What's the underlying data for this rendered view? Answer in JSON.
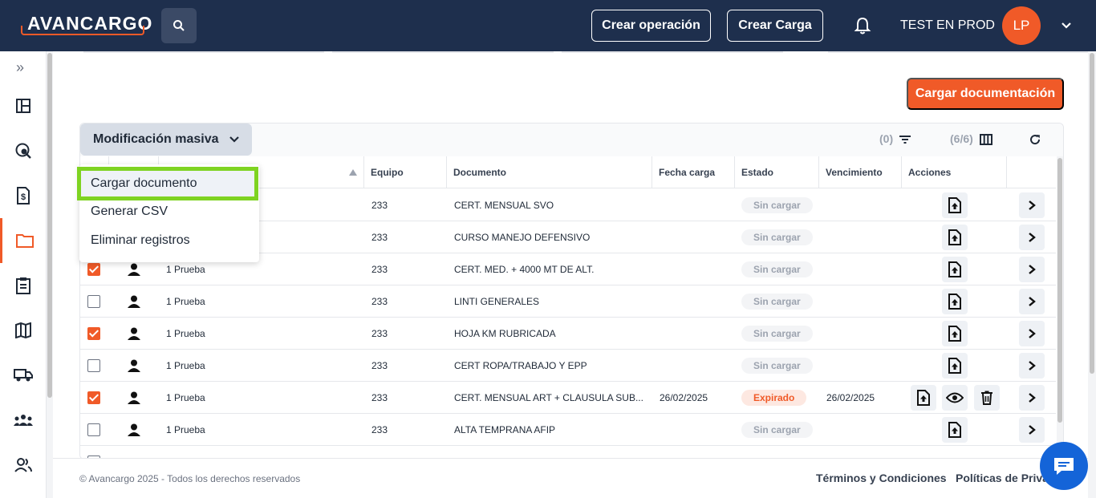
{
  "header": {
    "logo_text": "AVANCARGO",
    "crear_operacion": "Crear operación",
    "crear_carga": "Crear Carga",
    "username": "TEST EN PROD",
    "avatar_initials": "LP"
  },
  "main": {
    "cargar_documentacion": "Cargar documentación"
  },
  "toolbar": {
    "masiva_label": "Modificación masiva",
    "filter_count": "(0)",
    "columns_count": "(6/6)"
  },
  "dropdown": {
    "items": [
      "Cargar documento",
      "Generar CSV",
      "Eliminar registros"
    ]
  },
  "table": {
    "headers": {
      "equipo": "Equipo",
      "documento": "Documento",
      "fecha_carga": "Fecha carga",
      "estado": "Estado",
      "vencimiento": "Vencimiento",
      "acciones": "Acciones"
    },
    "rows": [
      {
        "checked": false,
        "name": "",
        "equipo": "233",
        "documento": "CERT. MENSUAL SVO",
        "fecha": "",
        "estado": "Sin cargar",
        "vencimiento": ""
      },
      {
        "checked": false,
        "name": "",
        "equipo": "233",
        "documento": "CURSO MANEJO DEFENSIVO",
        "fecha": "",
        "estado": "Sin cargar",
        "vencimiento": ""
      },
      {
        "checked": true,
        "name": "1 Prueba",
        "equipo": "233",
        "documento": "CERT. MED. + 4000 MT DE ALT.",
        "fecha": "",
        "estado": "Sin cargar",
        "vencimiento": ""
      },
      {
        "checked": false,
        "name": "1 Prueba",
        "equipo": "233",
        "documento": "LINTI GENERALES",
        "fecha": "",
        "estado": "Sin cargar",
        "vencimiento": ""
      },
      {
        "checked": true,
        "name": "1 Prueba",
        "equipo": "233",
        "documento": "HOJA KM RUBRICADA",
        "fecha": "",
        "estado": "Sin cargar",
        "vencimiento": ""
      },
      {
        "checked": false,
        "name": "1 Prueba",
        "equipo": "233",
        "documento": "CERT ROPA/TRABAJO Y EPP",
        "fecha": "",
        "estado": "Sin cargar",
        "vencimiento": ""
      },
      {
        "checked": true,
        "name": "1 Prueba",
        "equipo": "233",
        "documento": "CERT. MENSUAL ART + CLAUSULA SUB...",
        "fecha": "26/02/2025",
        "estado": "Expirado",
        "vencimiento": "26/02/2025"
      },
      {
        "checked": false,
        "name": "1 Prueba",
        "equipo": "233",
        "documento": "ALTA TEMPRANA AFIP",
        "fecha": "",
        "estado": "Sin cargar",
        "vencimiento": ""
      }
    ]
  },
  "footer": {
    "copyright": "© Avancargo 2025 - Todos los derechos reservados",
    "terminos": "Términos y Condiciones",
    "politicas": "Políticas de Priva"
  },
  "sidebar": {
    "items": [
      "dashboard-icon",
      "search-map-icon",
      "invoice-icon",
      "folder-icon",
      "clipboard-icon",
      "map-icon",
      "truck-icon",
      "group-icon",
      "people-icon"
    ]
  },
  "colors": {
    "brand_orange": "#f05a28",
    "navy": "#1e2f4d",
    "highlight_green": "#7ed321"
  }
}
